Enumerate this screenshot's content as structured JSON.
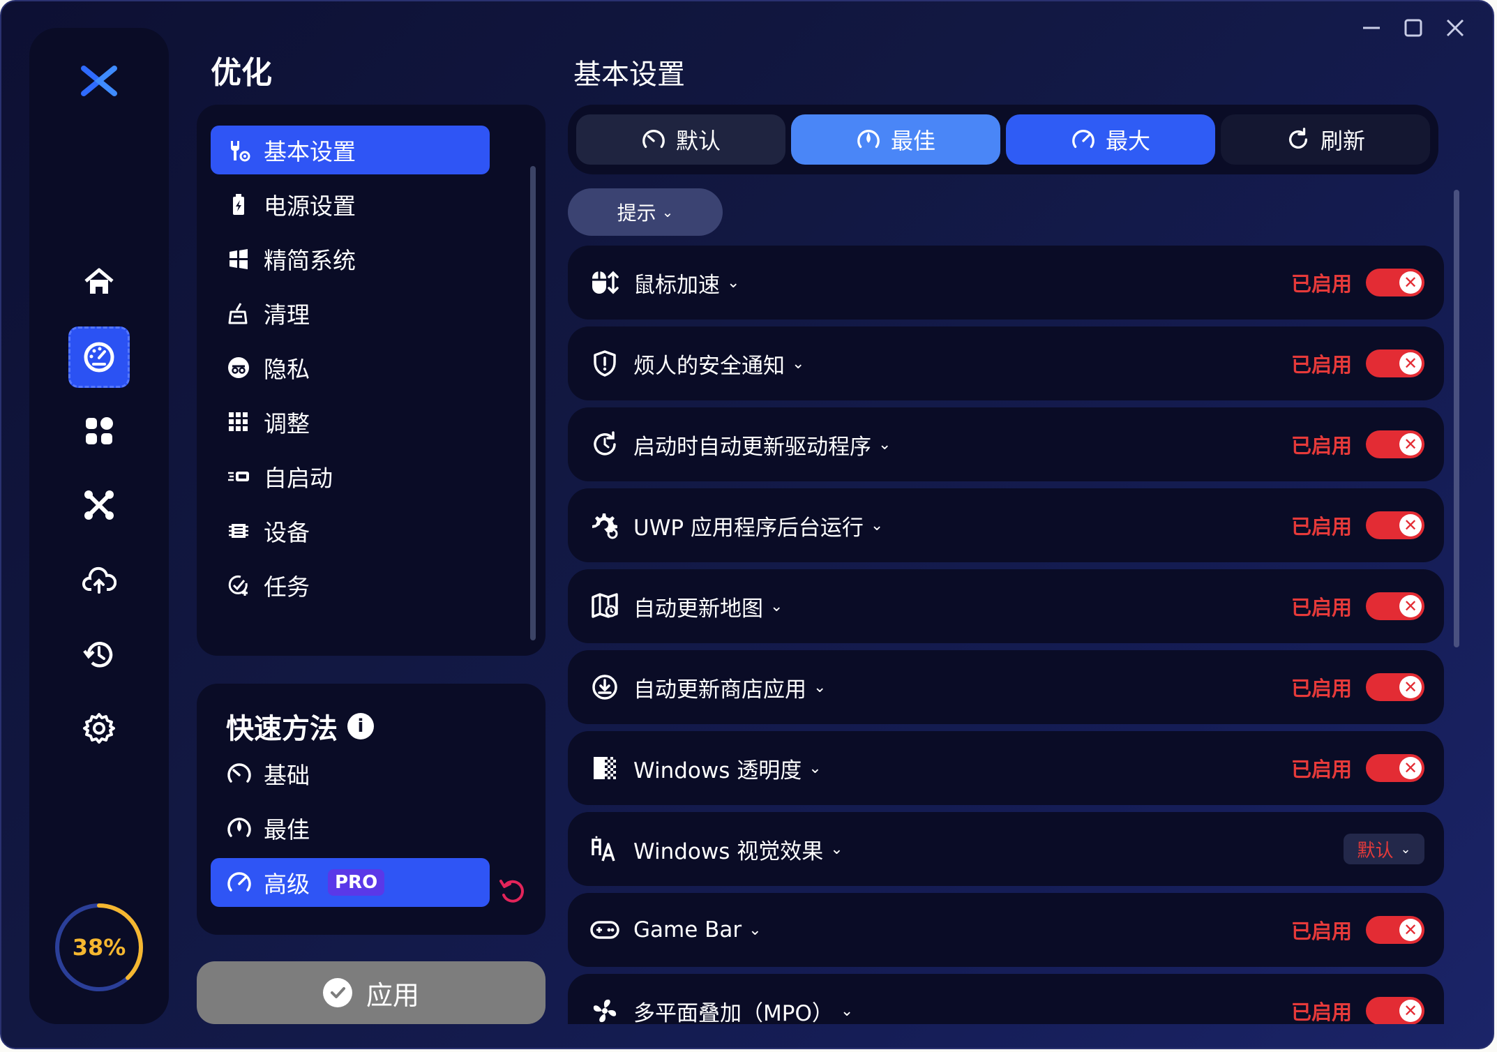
{
  "window": {
    "minimize_label": "–",
    "maximize_label": "☐",
    "close_label": "✕"
  },
  "rail": {
    "items": [
      {
        "name": "home-icon"
      },
      {
        "name": "dashboard-icon",
        "active": true
      },
      {
        "name": "apps-grid-icon"
      },
      {
        "name": "tools-icon"
      },
      {
        "name": "cloud-upload-icon"
      },
      {
        "name": "restore-icon"
      },
      {
        "name": "settings-gear-icon"
      }
    ],
    "progress": {
      "label": "38%",
      "value": 0.38
    }
  },
  "section": {
    "title": "优化"
  },
  "menu": {
    "items": [
      {
        "label": "基本设置",
        "icon": "wrench-icon",
        "active": true
      },
      {
        "label": "电源设置",
        "icon": "battery-icon"
      },
      {
        "label": "精简系统",
        "icon": "windows-icon"
      },
      {
        "label": "清理",
        "icon": "broom-icon"
      },
      {
        "label": "隐私",
        "icon": "incognito-icon"
      },
      {
        "label": "调整",
        "icon": "grid-dots-icon"
      },
      {
        "label": "自启动",
        "icon": "startup-icon"
      },
      {
        "label": "设备",
        "icon": "chip-icon"
      },
      {
        "label": "任务",
        "icon": "task-icon"
      }
    ]
  },
  "quick": {
    "title": "快速方法",
    "info_label": "i",
    "items": [
      {
        "label": "基础",
        "icon": "gauge-low-icon"
      },
      {
        "label": "最佳",
        "icon": "gauge-mid-icon"
      },
      {
        "label": "高级",
        "icon": "gauge-high-icon",
        "badge": "PRO",
        "active": true
      }
    ]
  },
  "apply": {
    "label": "应用"
  },
  "main": {
    "title": "基本设置",
    "presets": [
      {
        "label": "默认",
        "icon": "gauge-low-icon"
      },
      {
        "label": "最佳",
        "icon": "gauge-mid-icon"
      },
      {
        "label": "最大",
        "icon": "gauge-high-icon"
      },
      {
        "label": "刷新",
        "icon": "refresh-icon"
      }
    ],
    "hint": {
      "label": "提示"
    },
    "rows": [
      {
        "label": "鼠标加速",
        "icon": "mouse-icon",
        "status": "已启用"
      },
      {
        "label": "烦人的安全通知",
        "icon": "shield-icon",
        "status": "已启用"
      },
      {
        "label": "启动时自动更新驱动程序",
        "icon": "refresh-clock-icon",
        "status": "已启用"
      },
      {
        "label": "UWP 应用程序后台运行",
        "icon": "gear-cog-icon",
        "status": "已启用"
      },
      {
        "label": "自动更新地图",
        "icon": "map-icon",
        "status": "已启用"
      },
      {
        "label": "自动更新商店应用",
        "icon": "download-circle-icon",
        "status": "已启用"
      },
      {
        "label": "Windows 透明度",
        "icon": "transparency-icon",
        "status": "已启用"
      },
      {
        "label": "Windows 视觉效果",
        "icon": "visual-effects-icon",
        "dropdown": "默认"
      },
      {
        "label": "Game Bar",
        "icon": "gamepad-icon",
        "status": "已启用"
      },
      {
        "label": "多平面叠加（MPO）",
        "icon": "fan-icon",
        "status": "已启用"
      }
    ],
    "toggle_knob": "✕"
  },
  "colors": {
    "accent": "#2f55f5",
    "best": "#4a86f7",
    "danger": "#e32c34",
    "progress": "#f5b730"
  }
}
